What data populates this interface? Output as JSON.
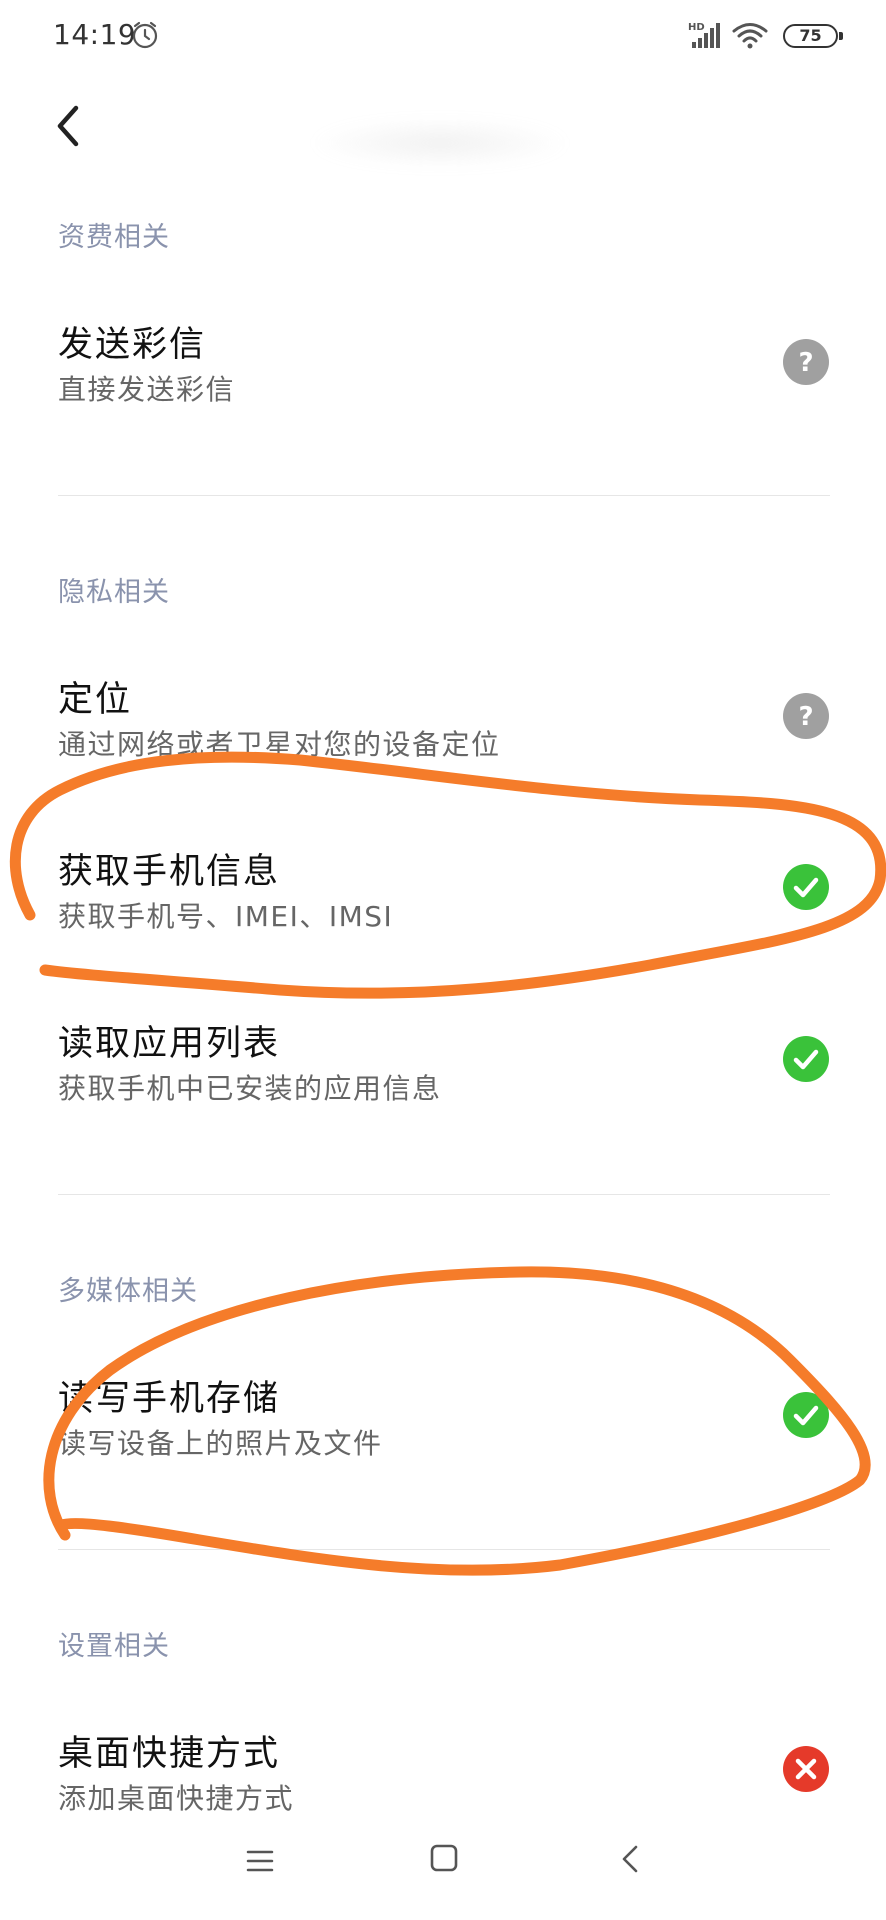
{
  "status_bar": {
    "time": "14:19",
    "battery": "75",
    "icons": [
      "alarm-icon",
      "hd-signal-icon",
      "wifi-icon",
      "battery-icon"
    ]
  },
  "header": {
    "back_icon": "chevron-left-icon"
  },
  "sections": [
    {
      "header": "资费相关",
      "items": [
        {
          "title": "发送彩信",
          "desc": "直接发送彩信",
          "status": "ask",
          "icon": "question-icon"
        }
      ]
    },
    {
      "header": "隐私相关",
      "items": [
        {
          "title": "定位",
          "desc": "通过网络或者卫星对您的设备定位",
          "status": "ask",
          "icon": "question-icon"
        },
        {
          "title": "获取手机信息",
          "desc": "获取手机号、IMEI、IMSI",
          "status": "allowed",
          "icon": "check-icon"
        },
        {
          "title": "读取应用列表",
          "desc": "获取手机中已安装的应用信息",
          "status": "allowed",
          "icon": "check-icon"
        }
      ]
    },
    {
      "header": "多媒体相关",
      "items": [
        {
          "title": "读写手机存储",
          "desc": "读写设备上的照片及文件",
          "status": "allowed",
          "icon": "check-icon"
        }
      ]
    },
    {
      "header": "设置相关",
      "items": [
        {
          "title": "桌面快捷方式",
          "desc": "添加桌面快捷方式",
          "status": "denied",
          "icon": "close-icon"
        }
      ]
    }
  ],
  "colors": {
    "section_header": "#8a93ad",
    "allowed": "#3ac23a",
    "ask": "#a0a0a0",
    "denied": "#e53a2a",
    "annotation": "#f57c2a"
  },
  "nav_bar": {
    "icons": [
      "menu-icon",
      "home-square-icon",
      "back-triangle-icon"
    ]
  }
}
